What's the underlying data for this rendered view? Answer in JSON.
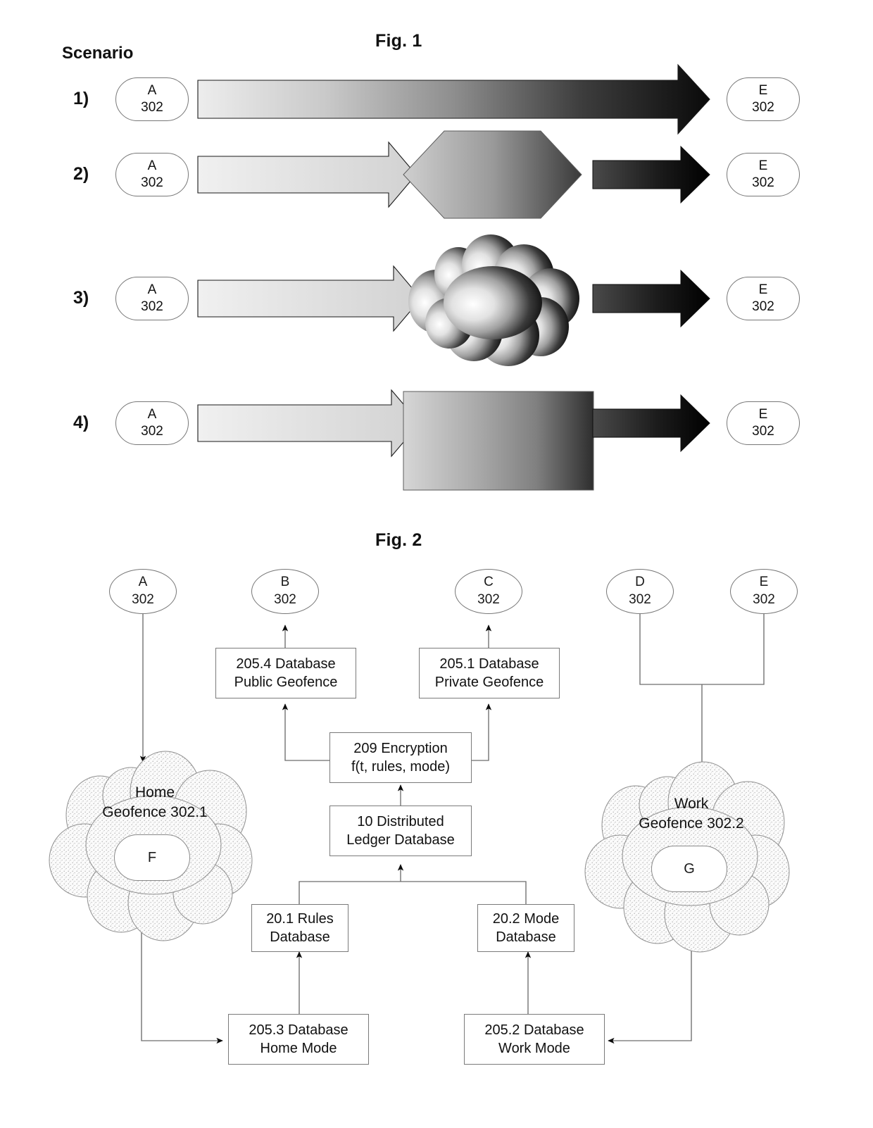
{
  "figure1": {
    "title": "Fig. 1",
    "scenario_header": "Scenario",
    "rows": [
      {
        "number": "1)",
        "source": {
          "id": "A",
          "ref": "302"
        },
        "target": {
          "id": "E",
          "ref": "302"
        },
        "middle": "none",
        "description": "direct gradient arrow"
      },
      {
        "number": "2)",
        "source": {
          "id": "A",
          "ref": "302"
        },
        "target": {
          "id": "E",
          "ref": "302"
        },
        "middle": "hexagon",
        "description": "light arrow into hexagon then dark arrow"
      },
      {
        "number": "3)",
        "source": {
          "id": "A",
          "ref": "302"
        },
        "target": {
          "id": "E",
          "ref": "302"
        },
        "middle": "cloud",
        "description": "light arrow into cloud then dark arrow"
      },
      {
        "number": "4)",
        "source": {
          "id": "A",
          "ref": "302"
        },
        "target": {
          "id": "E",
          "ref": "302"
        },
        "middle": "square",
        "description": "light arrow into square then dark arrow"
      }
    ]
  },
  "figure2": {
    "title": "Fig. 2",
    "top_nodes": [
      {
        "id": "A",
        "ref": "302"
      },
      {
        "id": "B",
        "ref": "302"
      },
      {
        "id": "C",
        "ref": "302"
      },
      {
        "id": "D",
        "ref": "302"
      },
      {
        "id": "E",
        "ref": "302"
      }
    ],
    "boxes": [
      {
        "key": "public_geofence",
        "line1": "205.4 Database",
        "line2": "Public Geofence"
      },
      {
        "key": "private_geofence",
        "line1": "205.1 Database",
        "line2": "Private Geofence"
      },
      {
        "key": "encryption",
        "line1": "209 Encryption",
        "line2": "f(t, rules, mode)"
      },
      {
        "key": "ledger",
        "line1": "10 Distributed",
        "line2": "Ledger Database"
      },
      {
        "key": "rules_db",
        "line1": "20.1 Rules",
        "line2": "Database"
      },
      {
        "key": "mode_db",
        "line1": "20.2 Mode",
        "line2": "Database"
      },
      {
        "key": "home_mode",
        "line1": "205.3 Database",
        "line2": "Home Mode"
      },
      {
        "key": "work_mode",
        "line1": "205.2 Database",
        "line2": "Work Mode"
      }
    ],
    "clouds": [
      {
        "key": "home",
        "line1": "Home",
        "line2": "Geofence 302.1",
        "node": "F"
      },
      {
        "key": "work",
        "line1": "Work",
        "line2": "Geofence 302.2",
        "node": "G"
      }
    ]
  },
  "colors": {
    "ink": "#1a1a1a",
    "box_border": "#7a7a7a",
    "node_border": "#777777",
    "gradient_light": "#e9e9e9",
    "gradient_dark": "#0d0d0d",
    "cloud_fill": "#f3f3f3",
    "cloud_stroke": "#8a8a8a"
  }
}
